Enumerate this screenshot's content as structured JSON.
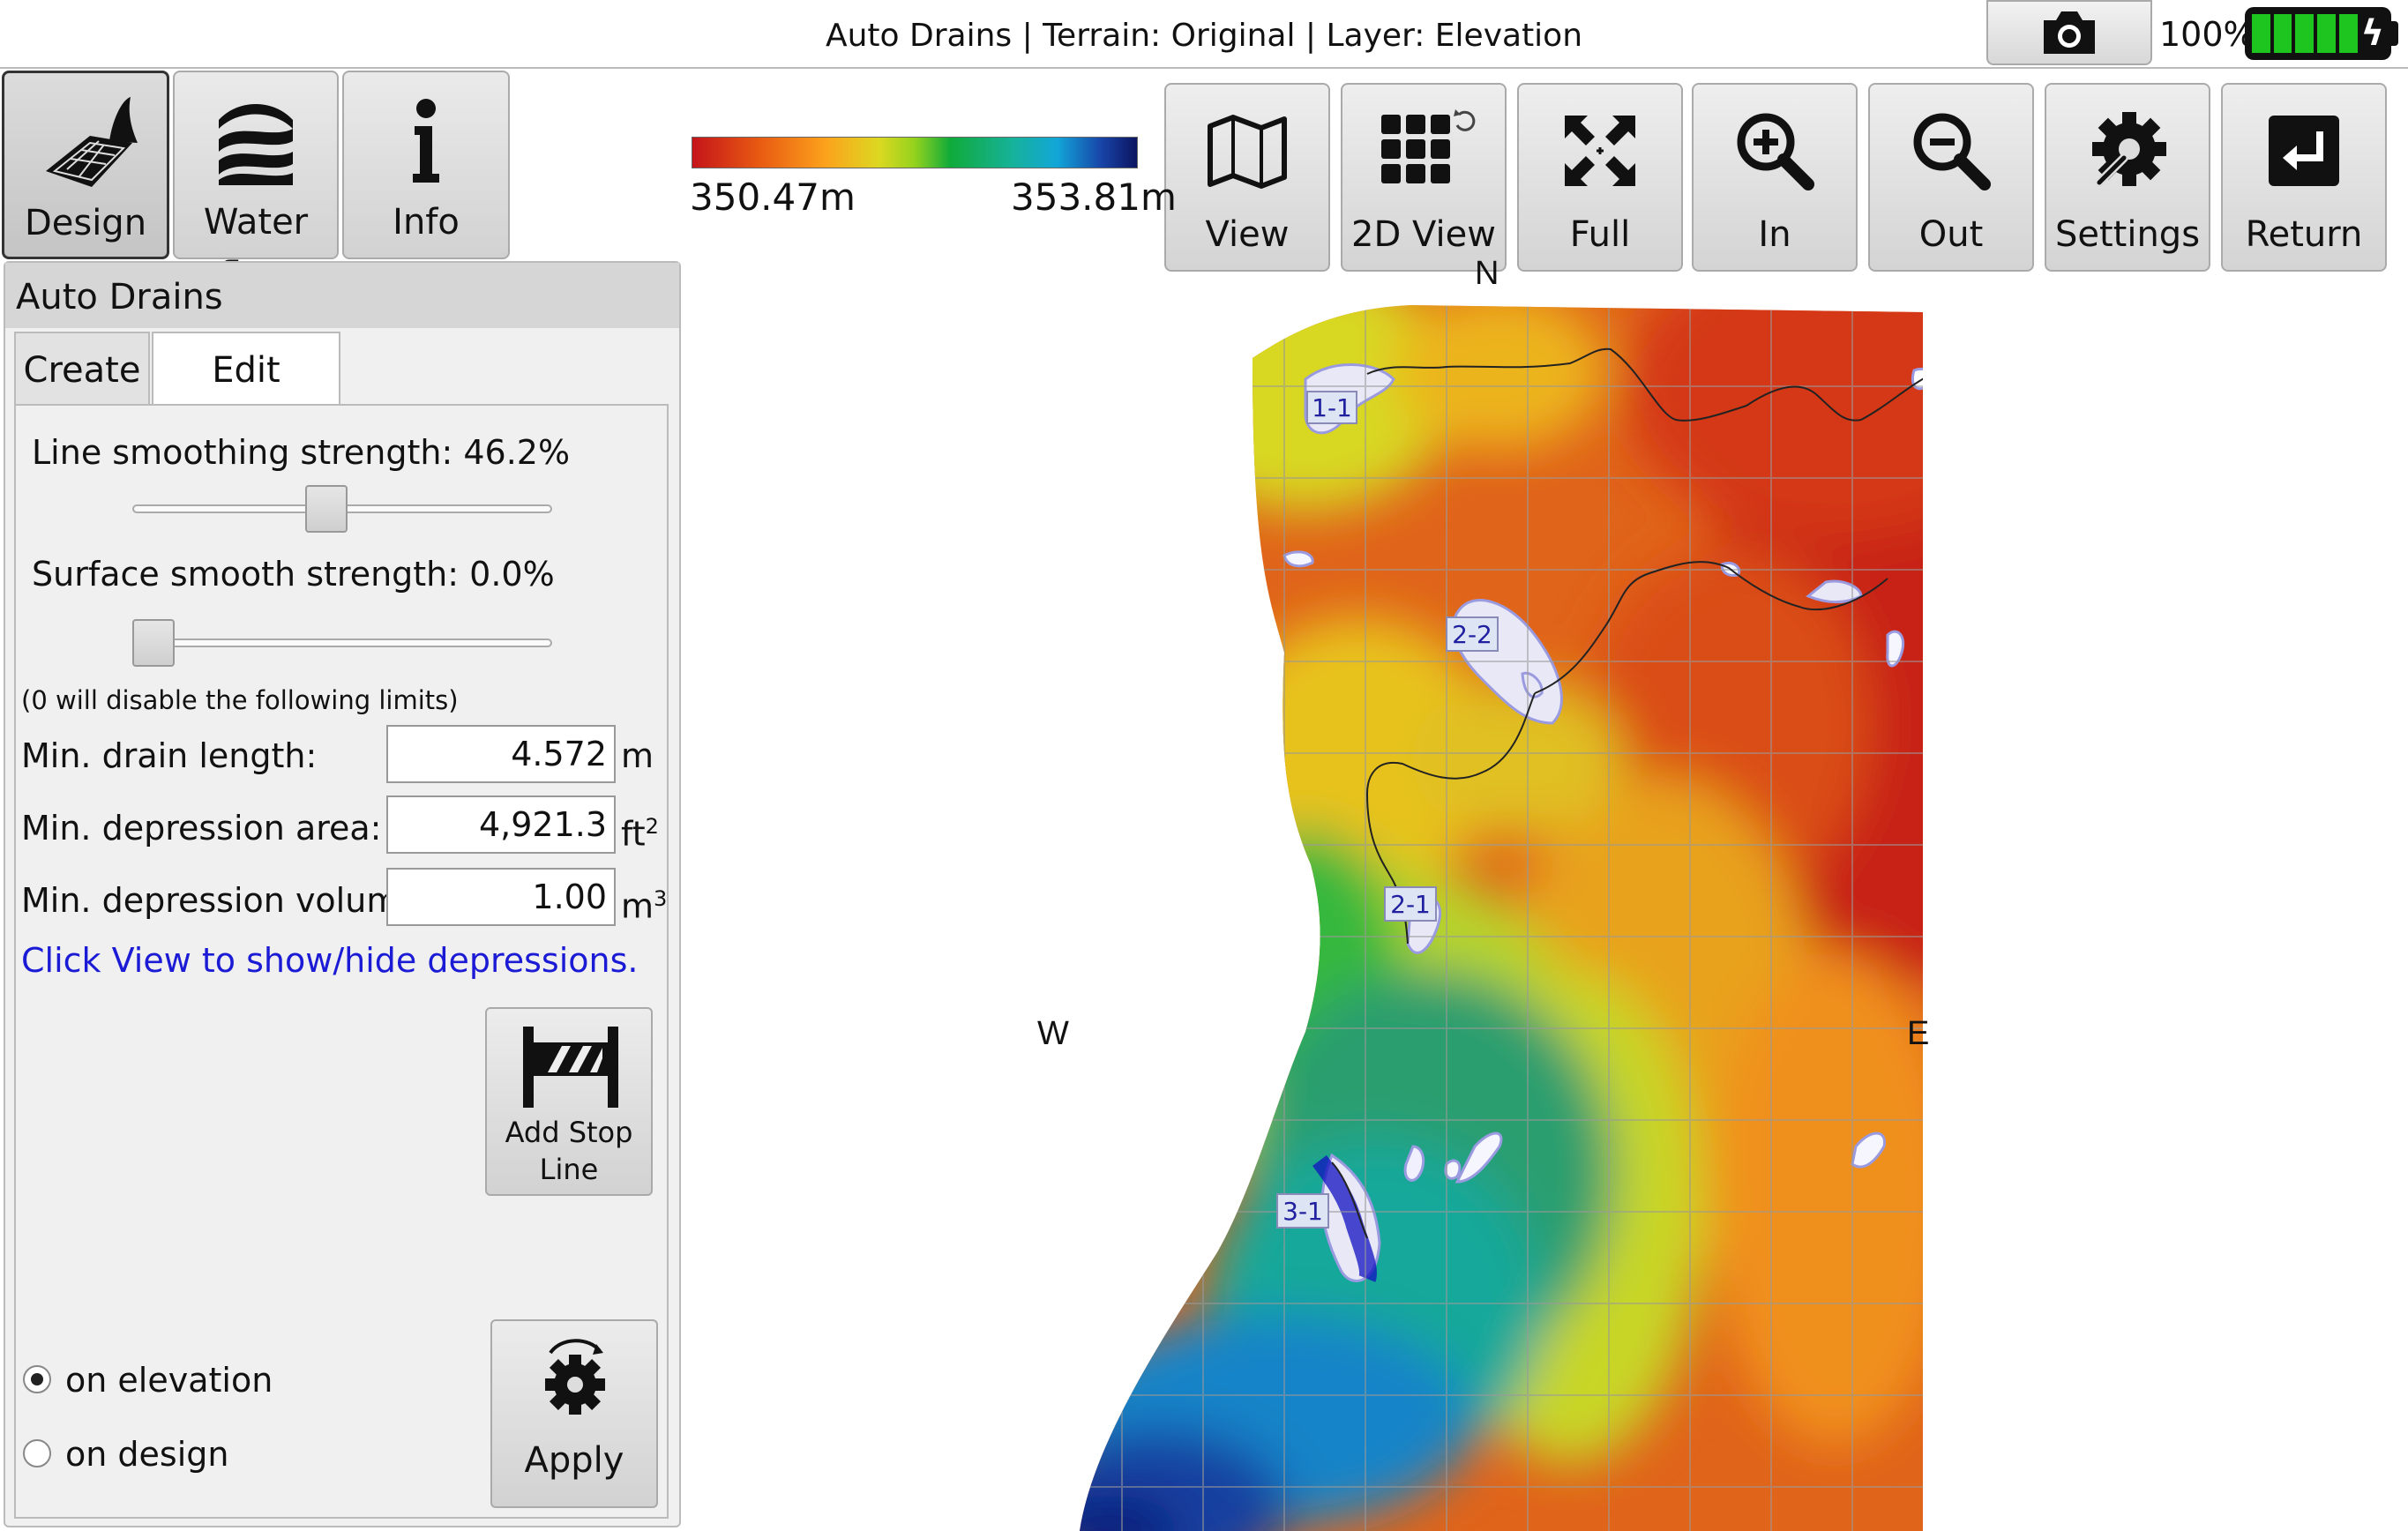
{
  "window": {
    "title": "Auto Drains | Terrain: Original | Layer: Elevation"
  },
  "status": {
    "battery_percent": "100%",
    "camera_icon": "camera-icon",
    "battery_icon": "battery-charging-icon"
  },
  "modes": [
    {
      "label": "Design",
      "icon": "design-field-icon",
      "active": true
    },
    {
      "label": "Water flow",
      "icon": "water-flow-icon",
      "active": false
    },
    {
      "label": "Info",
      "icon": "info-icon",
      "active": false
    }
  ],
  "panel": {
    "title": "Auto Drains",
    "tabs": [
      "Create",
      "Edit Drains"
    ],
    "line_smoothing_label": "Line smoothing strength: 46.2%",
    "line_smoothing_value": 0.462,
    "surface_smooth_label": "Surface smooth strength: 0.0%",
    "surface_smooth_value": 0.0,
    "limits_note": "(0 will disable the following limits)",
    "min_drain_length_label": "Min. drain length:",
    "min_drain_length_value": "4.572",
    "min_drain_length_unit": "m",
    "min_depression_area_label": "Min. depression area:",
    "min_depression_area_value": "4,921.3",
    "min_depression_area_unit": "ft",
    "min_depression_area_unit_sup": "2",
    "min_depression_volume_label": "Min. depression volume:",
    "min_depression_volume_value": "1.00",
    "min_depression_volume_unit": "m",
    "min_depression_volume_unit_sup": "3",
    "hint_link": "Click View to show/hide depressions.",
    "add_stop_line_label_1": "Add Stop",
    "add_stop_line_label_2": "Line",
    "apply_label": "Apply",
    "radio_options": [
      {
        "label": "on elevation",
        "selected": true
      },
      {
        "label": "on design",
        "selected": false
      }
    ]
  },
  "toolbar": [
    {
      "label": "View",
      "icon": "map-view-icon"
    },
    {
      "label": "2D View",
      "icon": "grid-2d-icon"
    },
    {
      "label": "Full",
      "icon": "fit-full-icon"
    },
    {
      "label": "In",
      "icon": "zoom-in-icon"
    },
    {
      "label": "Out",
      "icon": "zoom-out-icon"
    },
    {
      "label": "Settings",
      "icon": "settings-icon"
    },
    {
      "label": "Return",
      "icon": "return-icon"
    }
  ],
  "legend": {
    "min": "350.47m",
    "max": "353.81m"
  },
  "map": {
    "compass": {
      "north": "N",
      "west": "W",
      "east": "E"
    },
    "depressions": [
      "1-1",
      "2-2",
      "2-1",
      "3-1"
    ],
    "colors": {
      "high": "#c81e10",
      "mid": "#dcd820",
      "low": "#0c1a8a"
    }
  }
}
